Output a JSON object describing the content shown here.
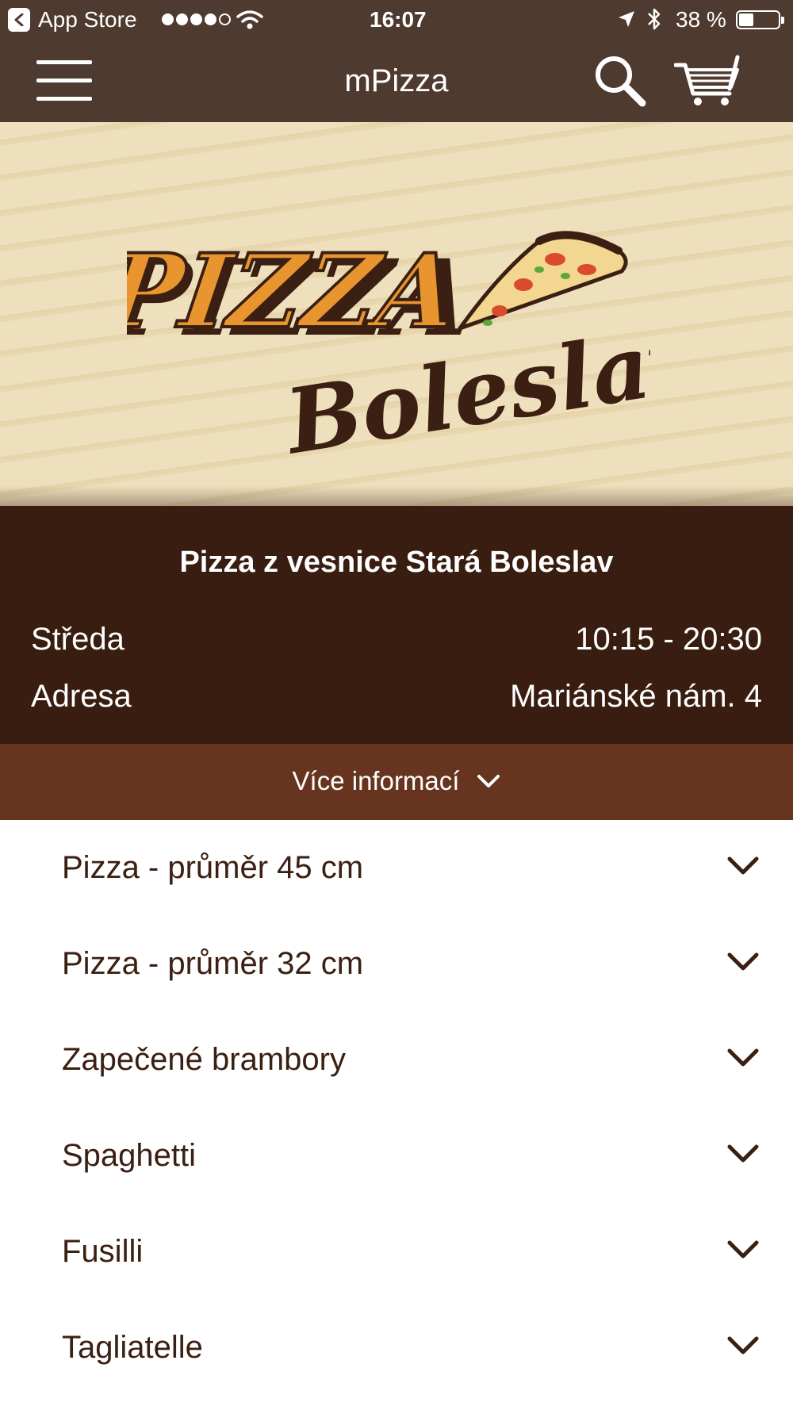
{
  "status_bar": {
    "back_app": "App Store",
    "time": "16:07",
    "battery": "38 %",
    "signal_bars_filled": 4,
    "signal_bars_total": 5
  },
  "nav": {
    "title": "mPizza",
    "icons": [
      "menu-icon",
      "search-icon",
      "cart-icon"
    ]
  },
  "hero": {
    "logo_text_top": "PIZZA",
    "logo_text_bottom": "Boleslav"
  },
  "info": {
    "title": "Pizza z vesnice Stará Boleslav",
    "rows": [
      {
        "label": "Středa",
        "value": "10:15 - 20:30"
      },
      {
        "label": "Adresa",
        "value": "Mariánské nám. 4"
      }
    ],
    "more_label": "Více informací"
  },
  "categories": [
    {
      "label": "Pizza - průměr 45 cm"
    },
    {
      "label": "Pizza - průměr 32 cm"
    },
    {
      "label": "Zapečené brambory"
    },
    {
      "label": "Spaghetti"
    },
    {
      "label": "Fusilli"
    },
    {
      "label": "Tagliatelle"
    }
  ],
  "colors": {
    "nav_bar": "#4e3a2f",
    "info_bg": "#381d10",
    "more_bg": "#66341f",
    "text_dark": "#3a1f12",
    "logo_orange": "#e8952f"
  }
}
